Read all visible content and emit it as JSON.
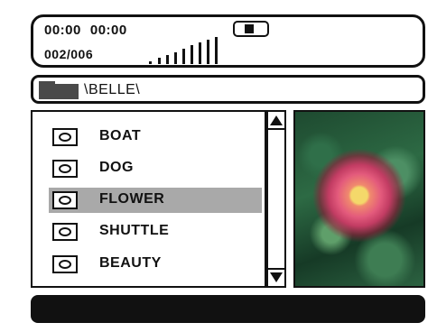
{
  "status": {
    "elapsed_time": "00:00",
    "total_time": "00:00",
    "track_counter": "002/006",
    "battery_icon": "battery-icon",
    "volume_icon": "volume-meter-icon"
  },
  "path_bar": {
    "folder_icon": "folder-icon",
    "path": "\\BELLE\\"
  },
  "file_list": {
    "items": [
      {
        "label": "BOAT",
        "icon": "image-file-icon",
        "selected": false
      },
      {
        "label": "DOG",
        "icon": "image-file-icon",
        "selected": false
      },
      {
        "label": "FLOWER",
        "icon": "image-file-icon",
        "selected": true
      },
      {
        "label": "SHUTTLE",
        "icon": "image-file-icon",
        "selected": false
      },
      {
        "label": "BEAUTY",
        "icon": "image-file-icon",
        "selected": false
      }
    ],
    "selected_color": "#a9a9a9"
  },
  "scrollbar": {
    "up_icon": "scroll-up-arrow-icon",
    "down_icon": "scroll-down-arrow-icon"
  },
  "preview": {
    "icon": "photo-preview"
  },
  "colors": {
    "foreground": "#111111",
    "background": "#ffffff",
    "message_bar": "#111111"
  }
}
